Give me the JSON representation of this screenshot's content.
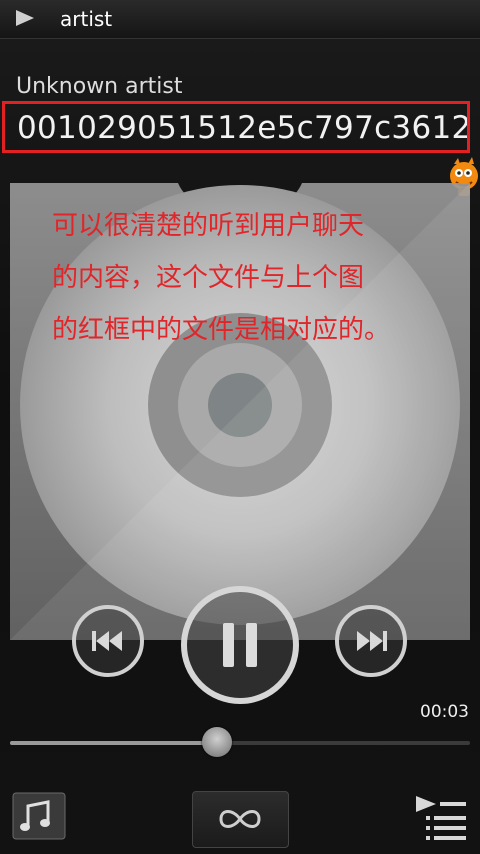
{
  "header": {
    "title": "artist",
    "icon": "play-icon"
  },
  "track": {
    "artist": "Unknown artist",
    "title": "001029051512e5c797c3612"
  },
  "annotation": {
    "color": "#e0262a",
    "lines": [
      "可以很清楚的听到用户聊天",
      "的内容，这个文件与上个图",
      "的红框中的文件是相对应的。"
    ]
  },
  "highlight_color": "#e22222",
  "controls": {
    "prev": "previous-icon",
    "play_pause": "pause-icon",
    "next": "next-icon"
  },
  "playback": {
    "time": "00:03",
    "progress": 0.45
  },
  "bottom_bar": {
    "library": "music-library-icon",
    "infinite": "infinite-icon",
    "playlist": "playlist-icon"
  }
}
